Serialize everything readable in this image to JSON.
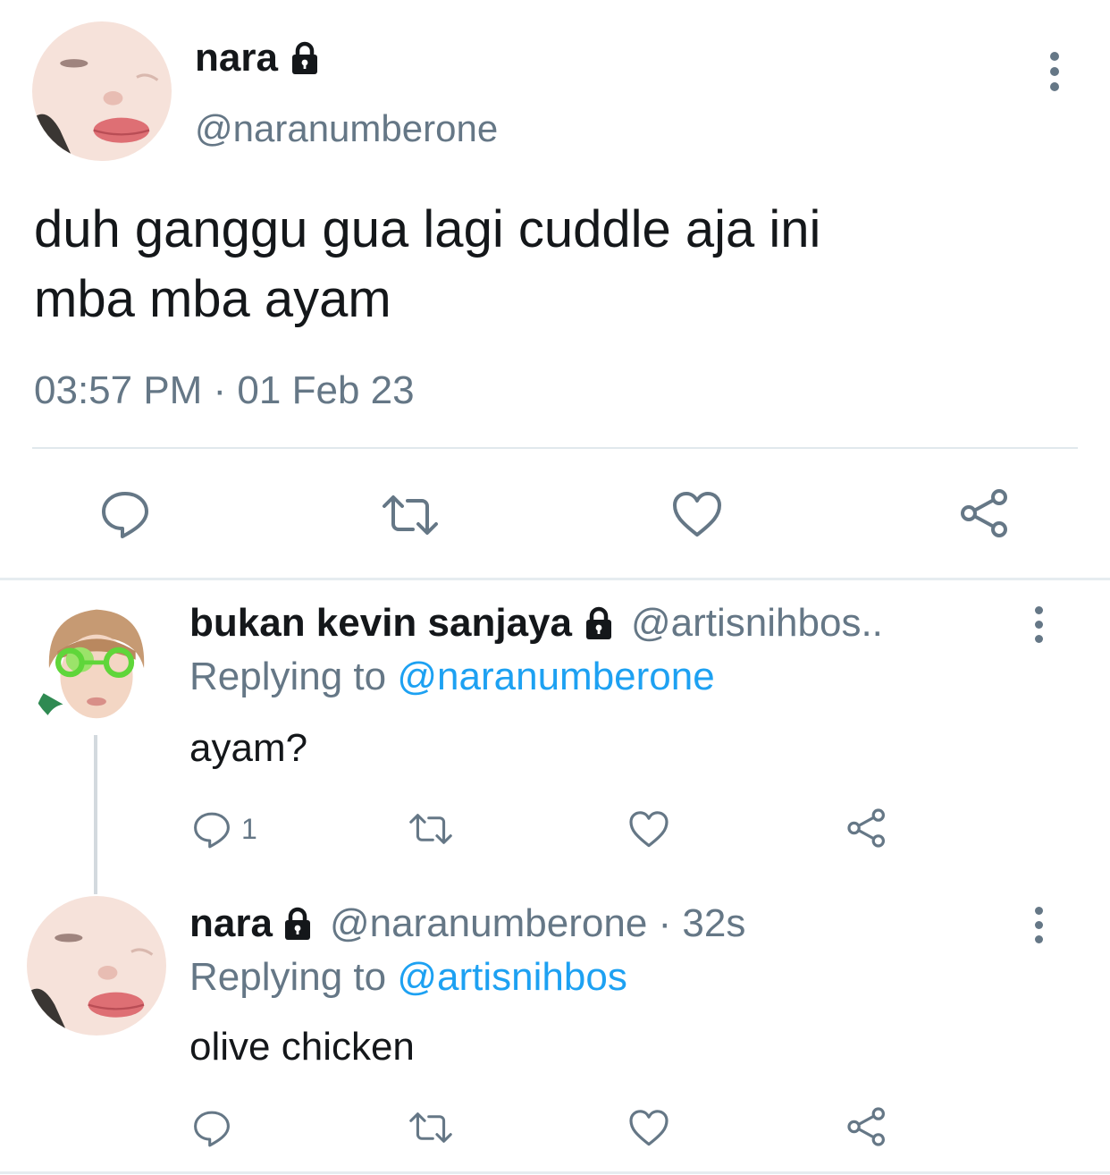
{
  "main_tweet": {
    "name": "nara",
    "handle": "@naranumberone",
    "text": "duh ganggu gua lagi cuddle aja ini\nmba mba ayam",
    "timestamp": "03:57 PM · 01 Feb 23",
    "actions": {
      "reply_icon": "comment-icon",
      "retweet_icon": "retweet-icon",
      "like_icon": "heart-icon",
      "share_icon": "share-icon"
    }
  },
  "replies": [
    {
      "name": "bukan kevin sanjaya",
      "handle": "@artisnihbos..",
      "replying_label": "Replying to",
      "replying_to": "@naranumberone",
      "text": "ayam?",
      "reply_count": "1"
    },
    {
      "name": "nara",
      "handle": "@naranumberone · 32s",
      "replying_label": "Replying to",
      "replying_to": "@artisnihbos",
      "text": "olive chicken",
      "reply_count": ""
    }
  ],
  "colors": {
    "text": "#14171a",
    "secondary": "#657786",
    "link": "#1da1f2",
    "divider": "#e1e8ed"
  }
}
